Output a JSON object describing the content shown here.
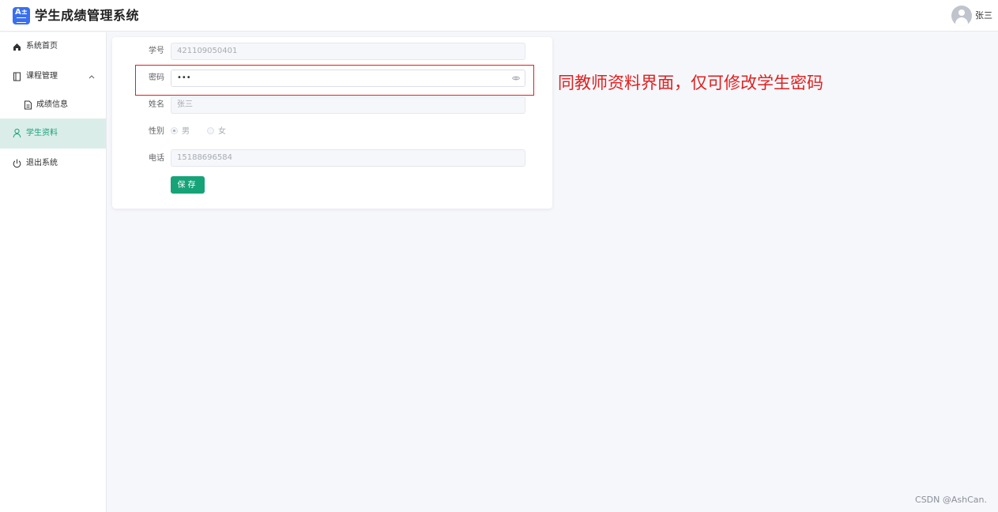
{
  "header": {
    "logo_text": "A±",
    "app_title": "学生成绩管理系统",
    "user_name": "张三"
  },
  "sidebar": {
    "items": [
      {
        "label": "系统首页",
        "icon": "home-icon"
      },
      {
        "label": "课程管理",
        "icon": "book-icon",
        "expanded": true
      },
      {
        "label": "成绩信息",
        "icon": "document-icon"
      },
      {
        "label": "学生资料",
        "icon": "user-icon",
        "active": true
      },
      {
        "label": "退出系统",
        "icon": "power-icon"
      }
    ]
  },
  "form": {
    "student_id": {
      "label": "学号",
      "value": "421109050401"
    },
    "password": {
      "label": "密码",
      "value": "•••"
    },
    "name": {
      "label": "姓名",
      "value": "张三"
    },
    "gender": {
      "label": "性别",
      "options": [
        "男",
        "女"
      ],
      "selected": "男"
    },
    "phone": {
      "label": "电话",
      "value": "15188696584"
    },
    "save_label": "保存"
  },
  "annotation": "同教师资料界面，仅可修改学生密码",
  "watermark": "CSDN @AshCan.",
  "colors": {
    "accent": "#17a378",
    "active_bg": "#dbede9",
    "annotation": "#e02020",
    "logo": "#3a6ff0"
  }
}
